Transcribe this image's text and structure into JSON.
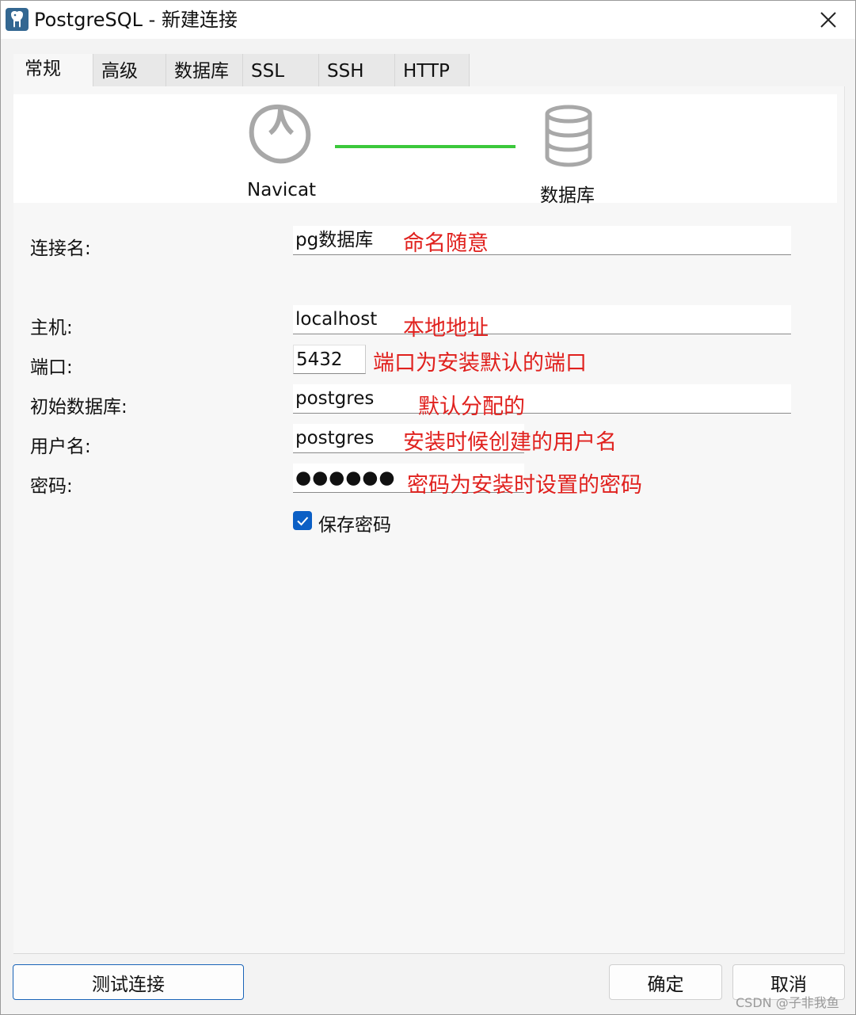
{
  "window": {
    "title": "PostgreSQL - 新建连接",
    "app_icon": "postgresql-elephant-icon",
    "close_icon": "close-icon"
  },
  "tabs": [
    {
      "label": "常规",
      "active": true
    },
    {
      "label": "高级",
      "active": false
    },
    {
      "label": "数据库",
      "active": false
    },
    {
      "label": "SSL",
      "active": false
    },
    {
      "label": "SSH",
      "active": false
    },
    {
      "label": "HTTP",
      "active": false
    }
  ],
  "diagram": {
    "left_label": "Navicat",
    "right_label": "数据库",
    "left_icon": "navicat-logo-icon",
    "right_icon": "database-icon",
    "link_color": "#3bc83b"
  },
  "form": {
    "connection_name": {
      "label": "连接名:",
      "value": "pg数据库",
      "annotation": "命名随意"
    },
    "host": {
      "label": "主机:",
      "value": "localhost",
      "annotation": "本地地址"
    },
    "port": {
      "label": "端口:",
      "value": "5432",
      "annotation": "端口为安装默认的端口"
    },
    "initial_db": {
      "label": "初始数据库:",
      "value": "postgres",
      "annotation": "默认分配的"
    },
    "username": {
      "label": "用户名:",
      "value": "postgres",
      "annotation": "安装时候创建的用户名"
    },
    "password": {
      "label": "密码:",
      "value": "●●●●●●",
      "annotation": "密码为安装时设置的密码"
    },
    "save_password": {
      "label": "保存密码",
      "checked": true
    }
  },
  "buttons": {
    "test": "测试连接",
    "ok": "确定",
    "cancel": "取消"
  },
  "watermark": "CSDN @子非我鱼",
  "colors": {
    "annotation": "#e0211e",
    "checkbox": "#0b5fc5",
    "primary_border": "#1a64b8"
  }
}
